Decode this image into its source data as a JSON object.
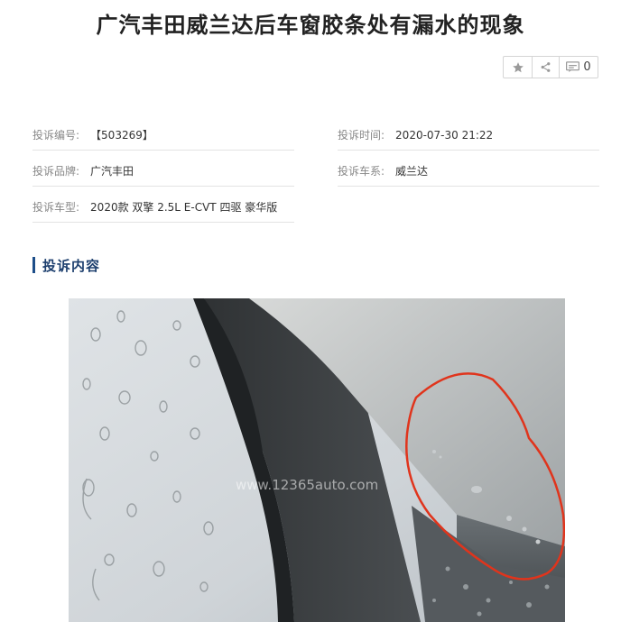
{
  "article": {
    "title": "广汽丰田威兰达后车窗胶条处有漏水的现象"
  },
  "actions": {
    "star_icon": "star-icon",
    "share_icon": "share-icon",
    "comment_icon": "comment-icon",
    "comment_count": "0"
  },
  "info": {
    "complaint_no_label": "投诉编号:",
    "complaint_no_value": "【503269】",
    "complaint_time_label": "投诉时间:",
    "complaint_time_value": "2020-07-30 21:22",
    "brand_label": "投诉品牌:",
    "brand_value": "广汽丰田",
    "series_label": "投诉车系:",
    "series_value": "威兰达",
    "model_label": "投诉车型:",
    "model_value": "2020款 双擎 2.5L E-CVT 四驱 豪华版"
  },
  "content": {
    "section_title": "投诉内容",
    "photo_watermark": "www.12365auto.com",
    "highlight_color": "#e0341c",
    "accent_color": "#1d4e89"
  }
}
